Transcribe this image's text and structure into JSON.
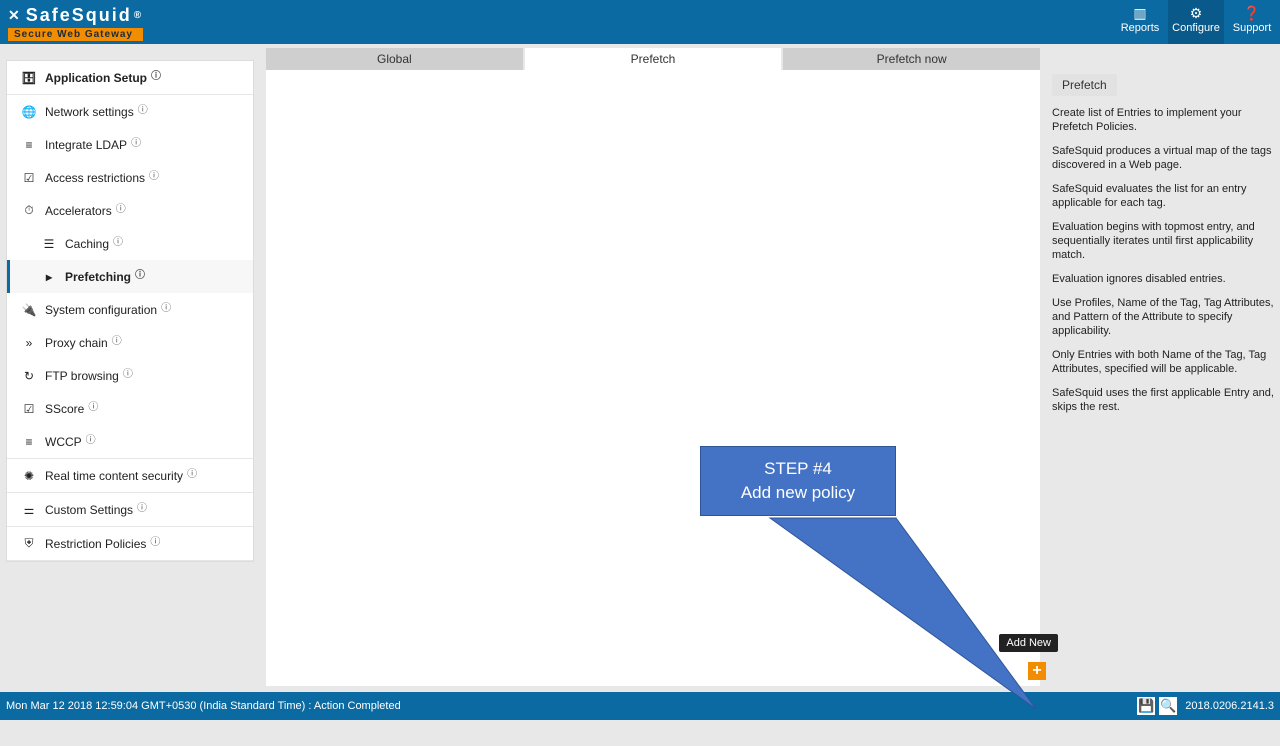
{
  "brand": {
    "name": "SafeSquid",
    "registered": "®",
    "tagline": "Secure Web Gateway"
  },
  "topnav": {
    "reports": "Reports",
    "configure": "Configure",
    "support": "Support"
  },
  "sidebar": {
    "app_setup": "Application Setup",
    "network_settings": "Network settings",
    "integrate_ldap": "Integrate LDAP",
    "access_restrictions": "Access restrictions",
    "accelerators": "Accelerators",
    "caching": "Caching",
    "prefetching": "Prefetching",
    "system_configuration": "System configuration",
    "proxy_chain": "Proxy chain",
    "ftp_browsing": "FTP browsing",
    "sscore": "SScore",
    "wccp": "WCCP",
    "realtime": "Real time content security",
    "custom_settings": "Custom Settings",
    "restriction_policies": "Restriction Policies"
  },
  "tabs": {
    "global": "Global",
    "prefetch": "Prefetch",
    "prefetch_now": "Prefetch now"
  },
  "info": {
    "badge": "Prefetch",
    "p1": "Create list of Entries to implement your Prefetch Policies.",
    "p2": "SafeSquid produces a virtual map of the tags discovered in a Web page.",
    "p3": "SafeSquid evaluates the list for an entry applicable for each tag.",
    "p4": "Evaluation begins with topmost entry, and sequentially iterates until first applicability match.",
    "p5": "Evaluation ignores disabled entries.",
    "p6": "Use Profiles, Name of the Tag, Tag Attributes, and Pattern of the Attribute to specify applicability.",
    "p7": "Only Entries with both Name of the Tag, Tag Attributes, specified will be applicable.",
    "p8": "SafeSquid uses the first applicable Entry and, skips the rest."
  },
  "callout": {
    "line1": "STEP #4",
    "line2": "Add new policy"
  },
  "tooltip": "Add New",
  "status": {
    "text": "Mon Mar 12 2018 12:59:04 GMT+0530 (India Standard Time) : Action Completed",
    "version": "2018.0206.2141.3"
  }
}
